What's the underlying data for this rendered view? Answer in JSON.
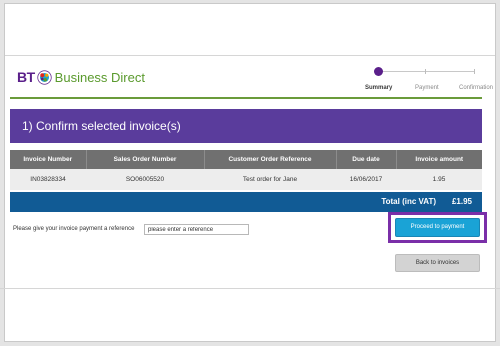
{
  "brand": {
    "logo_text": "BT",
    "name": "Business Direct",
    "purple": "#5a1f8a",
    "green": "#5a9a2d"
  },
  "steps": [
    {
      "label": "Summary",
      "active": true
    },
    {
      "label": "Payment",
      "active": false
    },
    {
      "label": "Confirmation",
      "active": false
    }
  ],
  "banner": {
    "title": "1) Confirm selected invoice(s)",
    "color": "#5a3c9c"
  },
  "table": {
    "headers": [
      "Invoice Number",
      "Sales Order Number",
      "Customer Order Reference",
      "Due date",
      "Invoice amount"
    ],
    "rows": [
      [
        "IN03828334",
        "SO06005520",
        "Test order for Jane",
        "16/06/2017",
        "1.95"
      ]
    ]
  },
  "total": {
    "label": "Total (inc VAT)",
    "amount": "£1.95",
    "color": "#115b95"
  },
  "reference": {
    "label": "Please give your invoice payment a reference",
    "value": "please enter a reference"
  },
  "buttons": {
    "proceed": "Proceed to payment",
    "back": "Back to invoices"
  },
  "colors": {
    "accent_blue": "#1aa3d6",
    "highlight": "#7a2fa8"
  }
}
